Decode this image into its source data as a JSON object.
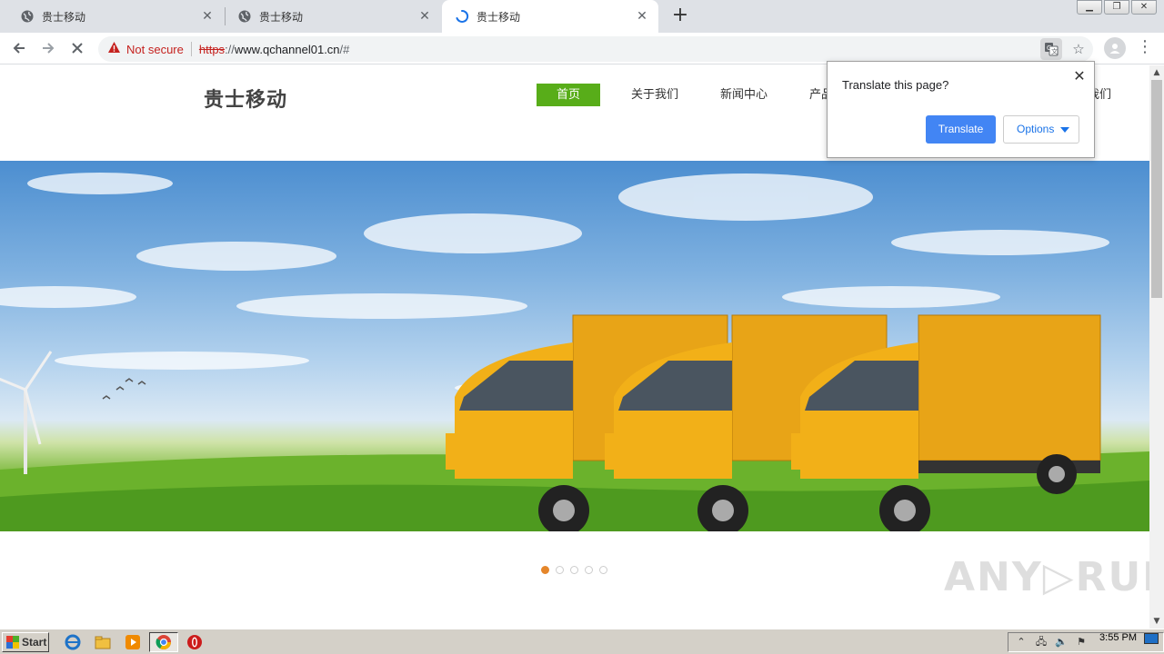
{
  "browser": {
    "tabs": [
      {
        "title": "贵士移动",
        "state": "inactive"
      },
      {
        "title": "贵士移动",
        "state": "inactive"
      },
      {
        "title": "贵士移动",
        "state": "loading"
      }
    ],
    "new_tab": "+",
    "security_label": "Not secure",
    "url_scheme": "https",
    "url_sep": "://",
    "url_host": "www.qchannel01.cn",
    "url_path": "/#"
  },
  "site": {
    "logo": "贵士移动",
    "nav": [
      "首页",
      "关于我们",
      "新闻中心",
      "产品与"
    ],
    "nav_tail": "我们",
    "carousel": {
      "slide_count": 5,
      "active_index": 0
    }
  },
  "translate_bubble": {
    "title": "Translate this page?",
    "translate_label": "Translate",
    "options_label": "Options"
  },
  "watermark": "ANY▷RUN",
  "taskbar": {
    "start_label": "Start",
    "clock": "3:55 PM"
  },
  "colors": {
    "nav_active": "#58ad19",
    "translate_button": "#4285f4",
    "dot_active": "#e5862a",
    "not_secure": "#c5221f"
  }
}
